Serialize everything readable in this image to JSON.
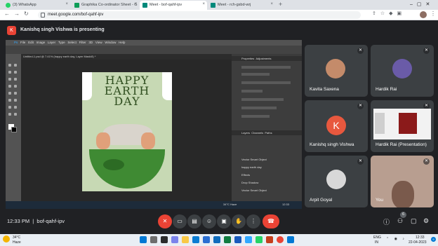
{
  "tabs": [
    {
      "label": "(3) WhatsApp",
      "color": "#25d366"
    },
    {
      "label": "Graphika Co-ordinator Sheet - G",
      "color": "#0f9d58"
    },
    {
      "label": "Meet - bof-qahf-ipv",
      "color": "#00897b"
    },
    {
      "label": "Meet - rch-gsbd-wrj",
      "color": "#00897b"
    }
  ],
  "address": "meet.google.com/bof-qahf-ipv",
  "presenting": {
    "badge": "K",
    "text": "Kanishq singh Vishwa is presenting"
  },
  "photoshop": {
    "menu": [
      "Ps",
      "File",
      "Edit",
      "Image",
      "Layer",
      "Type",
      "Select",
      "Filter",
      "3D",
      "View",
      "Window",
      "Help"
    ],
    "tab": "Untitled-1.psd @ 7.41% (happy earth day, Layer Mask/8) *",
    "status": "7.41%   1080 px x 1920 px (300 ppi)",
    "artwork": {
      "line1": "HAPPY",
      "line2": "EARTH",
      "line3": "DAY"
    },
    "panels": {
      "properties": "Properties",
      "adjustments": "Adjustments",
      "layers": "Layers",
      "channels": "Channels",
      "paths": "Paths"
    },
    "layer_items": [
      "Vector Smart Object",
      "happy earth day",
      "Effects",
      "Drop Shadow",
      "Vector Smart Object"
    ]
  },
  "participants": [
    {
      "name": "Kavita Saxena",
      "kind": "photo",
      "color": "#c48b6a"
    },
    {
      "name": "Hardik Rai",
      "kind": "photo",
      "color": "#6a5ba8"
    },
    {
      "name": "Kanishq singh Vishwa",
      "kind": "initial",
      "initial": "K",
      "color": "#e8583e"
    },
    {
      "name": "Hardik Rai (Presentation)",
      "kind": "screen",
      "color": "#ffffff"
    },
    {
      "name": "Arpit Goyal",
      "kind": "photo",
      "color": "#d8d8d8"
    },
    {
      "name": "You",
      "kind": "camera",
      "color": "#c9a99a"
    }
  ],
  "meeting": {
    "time": "12:33 PM",
    "code": "bof-qahf-ipv"
  },
  "taskbar": {
    "temp": "34°C",
    "weather": "Haze",
    "lang1": "ENG",
    "lang2": "IN",
    "clock": "12:33",
    "date": "22-04-2023",
    "badge": "9"
  },
  "ps_taskbar": {
    "temp": "34°C",
    "weather": "Haze",
    "clock": "12:33"
  },
  "other_participants_count": "6"
}
